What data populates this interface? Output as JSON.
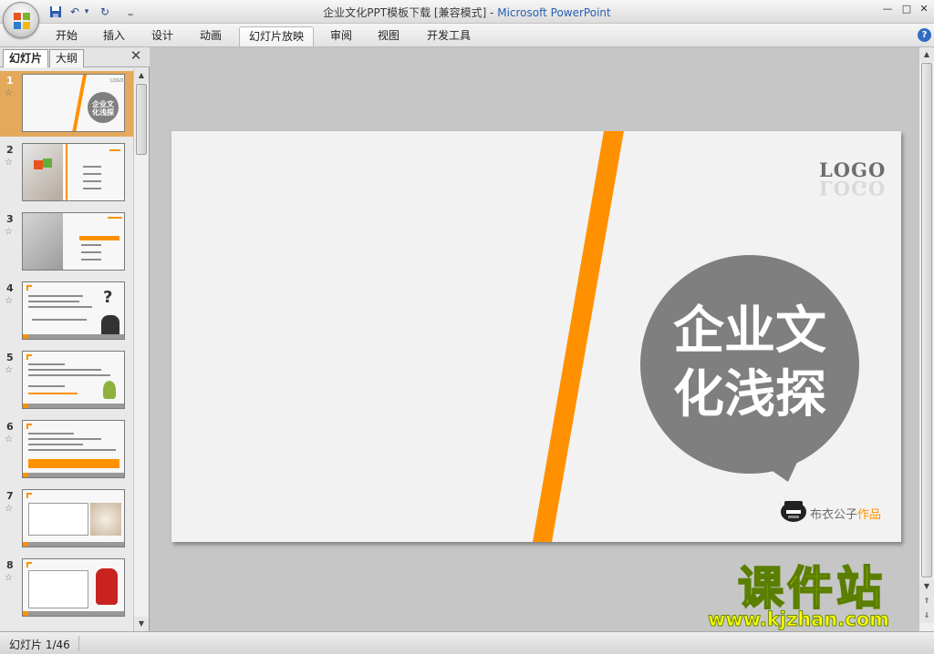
{
  "window": {
    "title_doc": "企业文化PPT模板下载 [兼容模式] - ",
    "title_app": "Microsoft PowerPoint"
  },
  "quick_access": {
    "save_icon": "save-icon",
    "undo_icon": "undo-icon",
    "redo_icon": "redo-icon",
    "customize_icon": "customize-qat-icon",
    "undo_glyph": "↶",
    "redo_glyph": "↻",
    "drop_glyph": "▾",
    "customize_glyph": "‗"
  },
  "window_controls": {
    "minimize": "—",
    "restore": "□",
    "close": "✕"
  },
  "ribbon": {
    "tabs": [
      {
        "label": "开始"
      },
      {
        "label": "插入"
      },
      {
        "label": "设计"
      },
      {
        "label": "动画"
      },
      {
        "label": "幻灯片放映"
      },
      {
        "label": "审阅"
      },
      {
        "label": "视图"
      },
      {
        "label": "开发工具"
      }
    ],
    "active_tab": "幻灯片放映",
    "help": "?"
  },
  "left_pane": {
    "tab_slides": "幻灯片",
    "tab_outline": "大纲",
    "close": "✕",
    "thumbnails": [
      {
        "num": "1",
        "star": "☆"
      },
      {
        "num": "2",
        "star": "☆"
      },
      {
        "num": "3",
        "star": "☆"
      },
      {
        "num": "4",
        "star": "☆"
      },
      {
        "num": "5",
        "star": "☆"
      },
      {
        "num": "6",
        "star": "☆"
      },
      {
        "num": "7",
        "star": "☆"
      },
      {
        "num": "8",
        "star": "☆"
      }
    ],
    "thumb1_text": "企业文化浅探",
    "thumb_small_logo": "LOGO"
  },
  "slide": {
    "logo": "LOGO",
    "title_line1": "企业文",
    "title_line2": "化浅探",
    "credit_plain": "布衣公子",
    "credit_highlight": "作品",
    "colors": {
      "accent": "#ff9100",
      "bubble": "#7f7f7f",
      "background": "#f2f2f2"
    }
  },
  "scroll": {
    "up": "▲",
    "down": "▼",
    "prev_slide": "⇑",
    "next_slide": "⇓"
  },
  "status_bar": {
    "slide_counter": "幻灯片 1/46"
  },
  "watermark": {
    "line1": "课件站",
    "line2": "www.kjzhan.com"
  }
}
